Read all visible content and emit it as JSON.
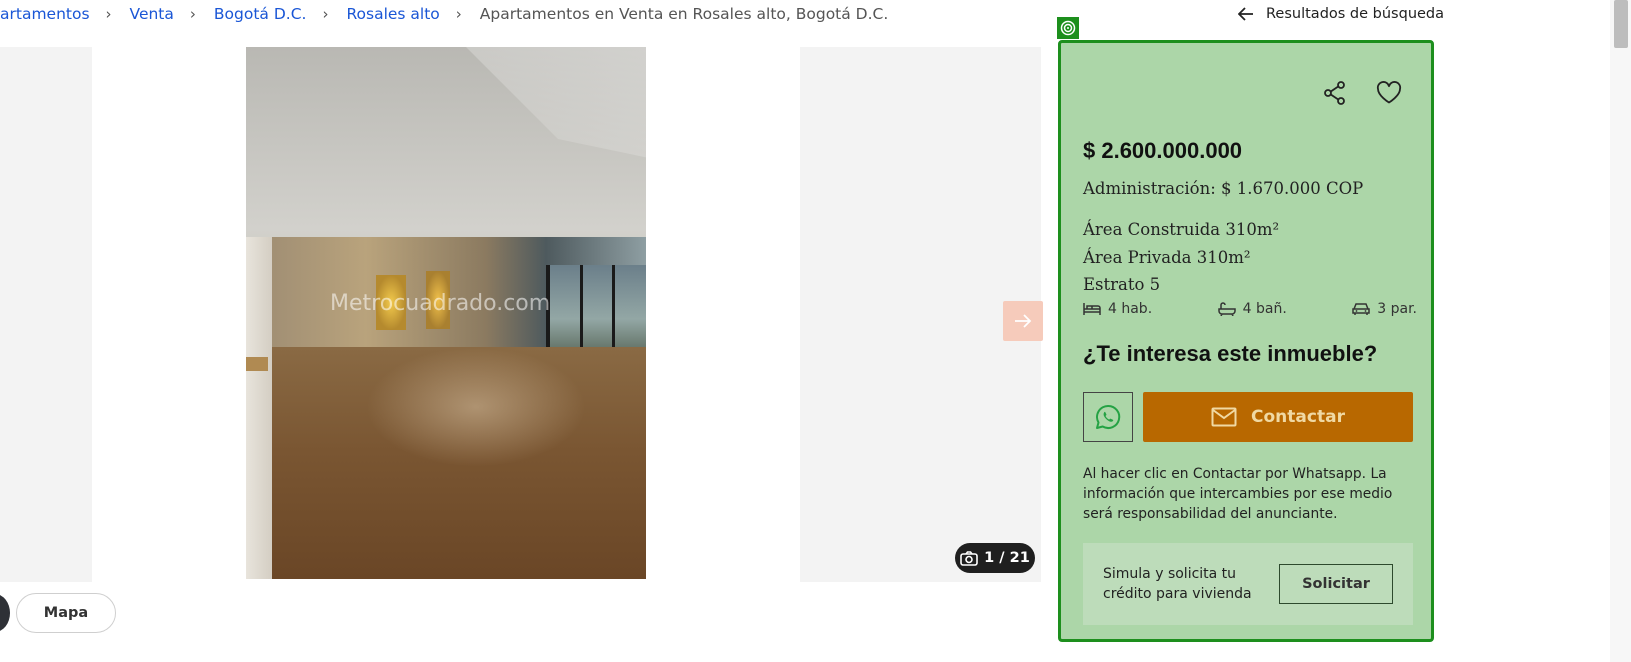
{
  "breadcrumb": {
    "items": [
      "artamentos",
      "Venta",
      "Bogotá D.C.",
      "Rosales alto"
    ],
    "current": "Apartamentos en Venta en Rosales alto, Bogotá D.C.",
    "separator": "›"
  },
  "back_link": {
    "label": "Resultados de búsqueda",
    "icon": "arrow-left-icon"
  },
  "gallery": {
    "watermark": "Metrocuadrado.com",
    "counter": "1 / 21",
    "next_icon": "arrow-right-icon",
    "counter_icon": "camera-icon"
  },
  "buttons": {
    "mapa": "Mapa"
  },
  "listing": {
    "price": "$ 2.600.000.000",
    "admin": "Administración: $ 1.670.000 COP",
    "features": [
      "Área Construida 310m²",
      "Área Privada 310m²",
      "Estrato 5"
    ],
    "amenities": [
      {
        "label": "4 hab.",
        "icon": "bed-icon"
      },
      {
        "label": "4 bañ.",
        "icon": "bathtub-icon"
      },
      {
        "label": "3 par.",
        "icon": "car-icon"
      }
    ]
  },
  "contact": {
    "interest_title": "¿Te interesa este inmueble?",
    "contact_label": "Contactar",
    "disclaimer": "Al hacer clic en Contactar por Whatsapp. La información que intercambies por ese medio será responsabilidad del anunciante.",
    "credit_text": "Simula y solicita tu crédito para vivienda",
    "credit_button": "Solicitar"
  },
  "colors": {
    "card_bg": "#acd6a8",
    "card_border": "#1d8f1d",
    "contact_button": "#b86800",
    "link": "#1a56d6",
    "whatsapp": "#25a244"
  }
}
